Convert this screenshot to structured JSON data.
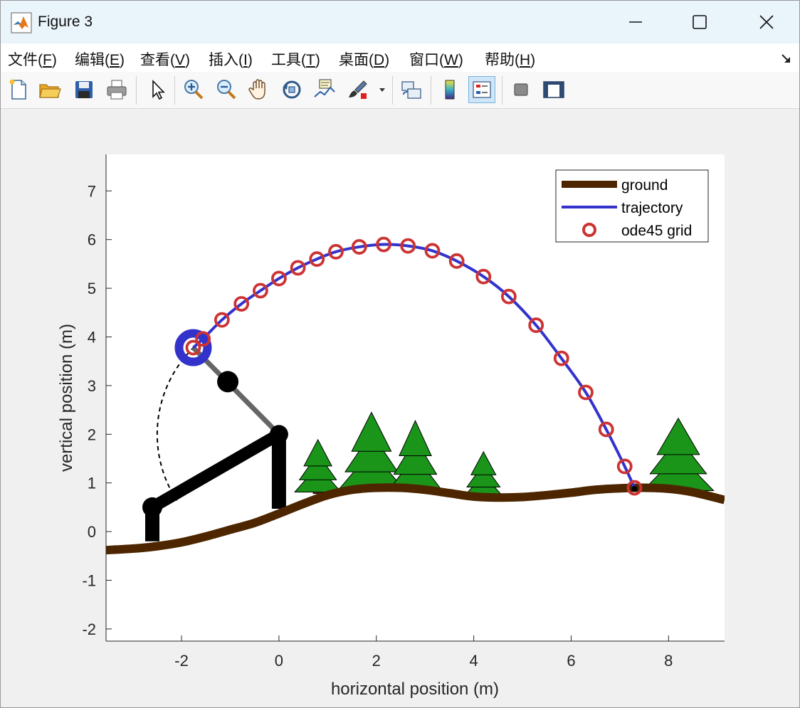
{
  "window": {
    "title": "Figure 3",
    "icons": {
      "app": "matlab-logo-icon",
      "minimize": "minimize-icon",
      "maximize": "maximize-icon",
      "close": "close-icon"
    }
  },
  "menubar": {
    "items": [
      {
        "label": "文件(",
        "mnemonic": "F",
        "suffix": ")"
      },
      {
        "label": "编辑(",
        "mnemonic": "E",
        "suffix": ")"
      },
      {
        "label": "查看(",
        "mnemonic": "V",
        "suffix": ")"
      },
      {
        "label": "插入(",
        "mnemonic": "I",
        "suffix": ")"
      },
      {
        "label": "工具(",
        "mnemonic": "T",
        "suffix": ")"
      },
      {
        "label": "桌面(",
        "mnemonic": "D",
        "suffix": ")"
      },
      {
        "label": "窗口(",
        "mnemonic": "W",
        "suffix": ")"
      },
      {
        "label": "帮助(",
        "mnemonic": "H",
        "suffix": ")"
      }
    ],
    "expand_icon": "dock-arrow-icon"
  },
  "toolbar": {
    "buttons": [
      {
        "icon": "new-figure-icon"
      },
      {
        "icon": "open-file-icon"
      },
      {
        "icon": "save-icon"
      },
      {
        "icon": "print-icon"
      },
      {
        "icon": "select-pointer-icon"
      },
      {
        "icon": "zoom-in-icon"
      },
      {
        "icon": "zoom-out-icon"
      },
      {
        "icon": "pan-hand-icon"
      },
      {
        "icon": "rotate-3d-icon"
      },
      {
        "icon": "data-cursor-icon"
      },
      {
        "icon": "brush-icon"
      },
      {
        "icon": "brush-dropdown-icon"
      },
      {
        "icon": "link-plot-icon"
      },
      {
        "icon": "colorbar-icon"
      },
      {
        "icon": "legend-icon",
        "active": true
      },
      {
        "icon": "hide-plot-tools-icon"
      },
      {
        "icon": "show-plot-tools-icon"
      }
    ]
  },
  "chart_data": {
    "type": "line",
    "xlabel": "horizontal position (m)",
    "ylabel": "vertical position (m)",
    "xlim": [
      -3.55,
      9.15
    ],
    "ylim": [
      -2.25,
      7.75
    ],
    "xticks": [
      -2,
      0,
      2,
      4,
      6,
      8
    ],
    "yticks": [
      -2,
      -1,
      0,
      1,
      2,
      3,
      4,
      5,
      6,
      7
    ],
    "tick_labels_x": [
      "-2",
      "0",
      "2",
      "4",
      "6",
      "8"
    ],
    "tick_labels_y": [
      "-2",
      "-1",
      "0",
      "1",
      "2",
      "3",
      "4",
      "5",
      "6",
      "7"
    ],
    "grid": false,
    "legend": {
      "location": "top-right",
      "entries": [
        "ground",
        "trajectory",
        "ode45 grid"
      ]
    },
    "colors": {
      "ground": "#4d2600",
      "trajectory": "#3333cc",
      "ode45": "#cc3333",
      "tree_foliage": "#1a9419",
      "tree_trunk": "#6e3520",
      "machine": "#000000",
      "arm": "#666666"
    },
    "series": [
      {
        "name": "ground",
        "x": [
          -3.55,
          -3.0,
          -2.5,
          -2.0,
          -1.5,
          -1.0,
          -0.5,
          0.0,
          0.5,
          1.0,
          1.5,
          2.0,
          2.5,
          3.0,
          3.5,
          4.0,
          4.5,
          5.0,
          5.5,
          6.0,
          6.5,
          7.0,
          7.5,
          8.0,
          8.5,
          9.15
        ],
        "y": [
          -0.38,
          -0.35,
          -0.3,
          -0.22,
          -0.1,
          0.04,
          0.18,
          0.37,
          0.57,
          0.75,
          0.86,
          0.9,
          0.9,
          0.86,
          0.79,
          0.72,
          0.7,
          0.71,
          0.75,
          0.8,
          0.86,
          0.89,
          0.9,
          0.88,
          0.81,
          0.65
        ]
      },
      {
        "name": "trajectory",
        "x": [
          -1.76,
          -1.56,
          -1.17,
          -0.77,
          -0.38,
          0.0,
          0.39,
          0.78,
          1.17,
          1.65,
          2.15,
          2.65,
          3.15,
          3.65,
          4.2,
          4.72,
          5.28,
          5.8,
          6.3,
          6.72,
          7.1,
          7.3
        ],
        "y": [
          3.78,
          3.96,
          4.35,
          4.68,
          4.95,
          5.2,
          5.42,
          5.6,
          5.75,
          5.85,
          5.9,
          5.87,
          5.77,
          5.56,
          5.24,
          4.83,
          4.24,
          3.56,
          2.86,
          2.1,
          1.34,
          0.9
        ]
      },
      {
        "name": "ode45 grid",
        "x": [
          -1.76,
          -1.56,
          -1.17,
          -0.77,
          -0.38,
          0.0,
          0.39,
          0.78,
          1.17,
          1.65,
          2.15,
          2.65,
          3.15,
          3.65,
          4.2,
          4.72,
          5.28,
          5.8,
          6.3,
          6.72,
          7.1,
          7.3
        ],
        "y": [
          3.78,
          3.96,
          4.35,
          4.68,
          4.95,
          5.2,
          5.42,
          5.6,
          5.75,
          5.85,
          5.9,
          5.87,
          5.77,
          5.56,
          5.24,
          4.83,
          4.24,
          3.56,
          2.86,
          2.1,
          1.34,
          0.9
        ]
      }
    ],
    "trees": [
      {
        "x": 0.8,
        "base": 0.84,
        "height": 1.05,
        "width": 0.95
      },
      {
        "x": 1.9,
        "base": 0.9,
        "height": 1.55,
        "width": 1.35
      },
      {
        "x": 2.8,
        "base": 0.88,
        "height": 1.4,
        "width": 1.1
      },
      {
        "x": 4.2,
        "base": 0.72,
        "height": 0.92,
        "width": 0.85
      },
      {
        "x": 8.2,
        "base": 0.88,
        "height": 1.45,
        "width": 1.45
      }
    ],
    "catapult": {
      "rear_post": {
        "x": -2.6,
        "y0": -0.2,
        "y1": 0.5
      },
      "front_post": {
        "x": 0.0,
        "y0": 0.47,
        "y1": 2.0
      },
      "beam": {
        "x0": -2.6,
        "y0": 0.5,
        "x1": 0.0,
        "y1": 2.0
      },
      "arm": {
        "x0": 0.0,
        "y0": 2.0,
        "x1": -1.76,
        "y1": 3.78
      },
      "counterweight": {
        "x": -1.05,
        "y": 3.08
      },
      "projectile": {
        "x": -1.76,
        "y": 3.78
      },
      "swing_arc": {
        "cx": 0.0,
        "cy": 2.0,
        "r": 2.5,
        "from_deg": 134,
        "to_deg": 213
      },
      "impact_point": {
        "x": 7.3,
        "y": 0.88
      }
    }
  }
}
